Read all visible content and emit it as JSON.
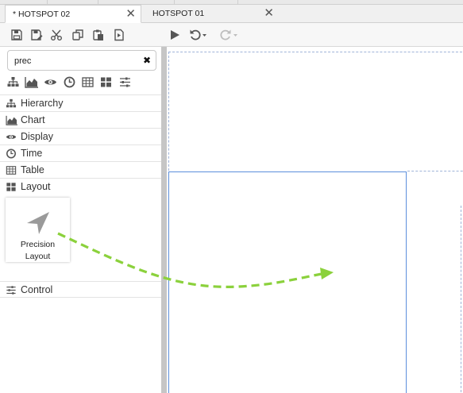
{
  "tabs": [
    {
      "label": "* HOTSPOT 02",
      "active": true
    },
    {
      "label": "HOTSPOT 01",
      "active": false
    }
  ],
  "tab_close_glyph": "✕",
  "toolbar": {
    "left_icons": [
      "save-icon",
      "save-as-icon",
      "cut-icon",
      "copy-icon",
      "paste-icon",
      "export-icon"
    ],
    "right_icons": [
      "play-icon",
      "undo-icon",
      "redo-icon"
    ]
  },
  "search": {
    "value": "prec",
    "placeholder": ""
  },
  "filter_icons": [
    "hierarchy-icon",
    "chart-icon",
    "eye-icon",
    "clock-icon",
    "table-icon",
    "layout-icon",
    "sliders-icon"
  ],
  "categories": [
    {
      "label": "Hierarchy",
      "icon": "hierarchy-icon"
    },
    {
      "label": "Chart",
      "icon": "chart-icon"
    },
    {
      "label": "Display",
      "icon": "eye-icon"
    },
    {
      "label": "Time",
      "icon": "clock-icon"
    },
    {
      "label": "Table",
      "icon": "table-icon"
    },
    {
      "label": "Layout",
      "icon": "layout-icon"
    }
  ],
  "component": {
    "label_line1": "Precision",
    "label_line2": "Layout",
    "icon": "navigation-arrow-icon"
  },
  "control_category": {
    "label": "Control",
    "icon": "sliders-icon"
  },
  "colors": {
    "accent_blue": "#5c8fdc",
    "drag_arrow_green": "#8bd13c",
    "icon_gray": "#555555"
  }
}
